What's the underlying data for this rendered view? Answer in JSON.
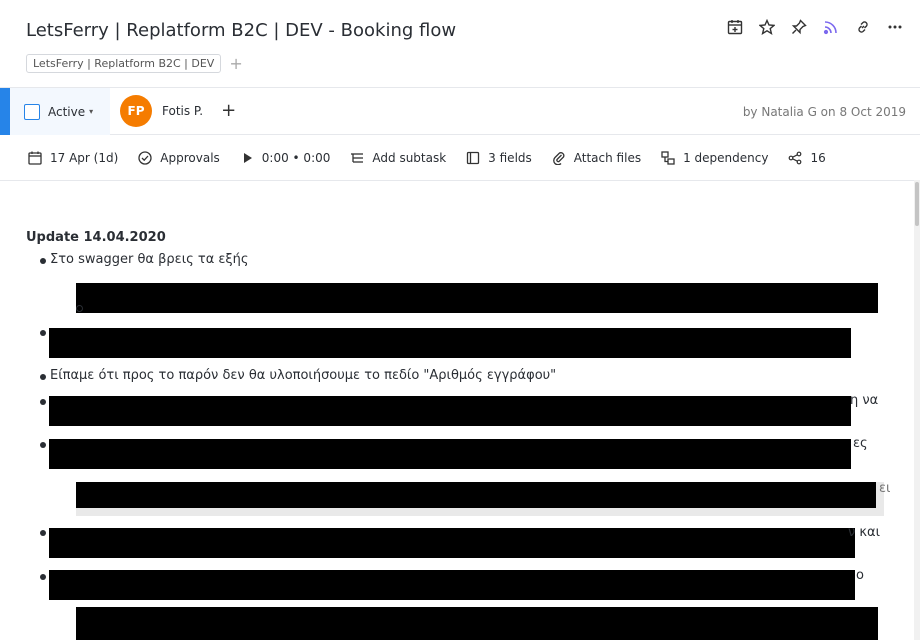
{
  "header": {
    "title": "LetsFerry | Replatform B2C | DEV - Booking flow",
    "breadcrumb": "LetsFerry | Replatform B2C | DEV",
    "breadcrumb_add": "+"
  },
  "toolbar_icons": [
    "calendar-plus-icon",
    "star-icon",
    "pin-icon",
    "rss-icon",
    "link-icon",
    "more-icon"
  ],
  "status": {
    "label": "Active",
    "caret": "▾",
    "accent": "#2684e8"
  },
  "assignee": {
    "initials": "FP",
    "name": "Fotis P.",
    "add": "+",
    "avatar_color": "#f57c00"
  },
  "created_by": "by Natalia G on 8 Oct 2019",
  "meta": {
    "date": "17 Apr (1d)",
    "approvals": "Approvals",
    "timer": "0:00 • 0:00",
    "add_subtask": "Add subtask",
    "fields": "3 fields",
    "attach": "Attach files",
    "dependency": "1 dependency",
    "share_count": "16"
  },
  "body": {
    "heading": "Update 14.04.2020",
    "line1": "Στο swagger θα βρεις τα εξής",
    "line2": "Είπαμε ότι προς το παρόν δεν θα υλοποιήσουμε το πεδίο \"Αριθμός εγγράφου\"",
    "frag_na": "η να",
    "frag_es": "ες",
    "frag_ei": "ει",
    "frag_kai": "ν και",
    "frag_o": "ο"
  }
}
